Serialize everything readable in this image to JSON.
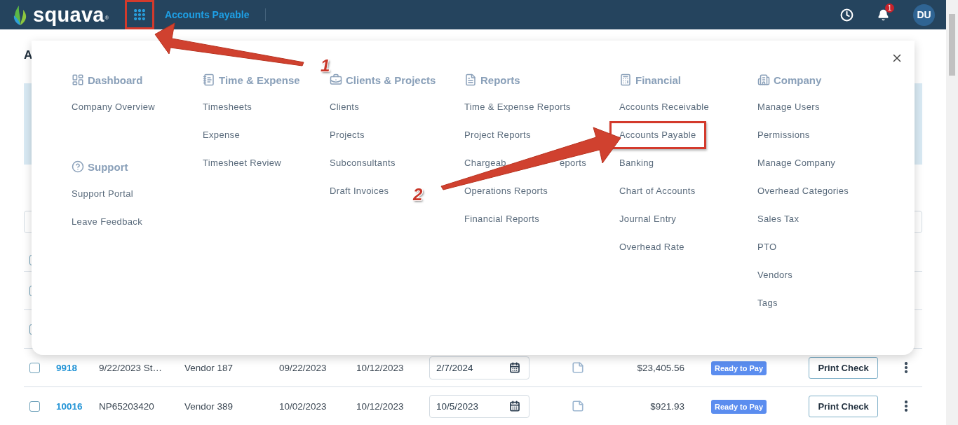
{
  "header": {
    "logo_text": "squava",
    "logo_mark": "®",
    "apps_button": {
      "highlighted": true
    },
    "page_link": "Accounts Payable",
    "notification_count": "1",
    "avatar": "DU"
  },
  "page": {
    "title_visible": "A"
  },
  "menu": {
    "columns": [
      {
        "groups": [
          {
            "title": "Dashboard",
            "items": [
              {
                "label": "Company Overview",
                "highlighted": false
              }
            ]
          },
          {
            "title": "Support",
            "items": [
              {
                "label": "Support Portal",
                "highlighted": false
              },
              {
                "label": "Leave Feedback",
                "highlighted": false
              }
            ]
          }
        ]
      },
      {
        "groups": [
          {
            "title": "Time & Expense",
            "items": [
              {
                "label": "Timesheets",
                "highlighted": false
              },
              {
                "label": "Expense",
                "highlighted": false
              },
              {
                "label": "Timesheet Review",
                "highlighted": false
              }
            ]
          }
        ]
      },
      {
        "groups": [
          {
            "title": "Clients & Projects",
            "items": [
              {
                "label": "Clients",
                "highlighted": false
              },
              {
                "label": "Projects",
                "highlighted": false
              },
              {
                "label": "Subconsultants",
                "highlighted": false
              },
              {
                "label": "Draft Invoices",
                "highlighted": false
              }
            ]
          }
        ]
      },
      {
        "groups": [
          {
            "title": "Reports",
            "items": [
              {
                "label": "Time & Expense Reports",
                "highlighted": false
              },
              {
                "label": "Project Reports",
                "highlighted": false
              },
              {
                "label": "Chargeab",
                "label_tail": "eports",
                "highlighted": false
              },
              {
                "label": "Operations Reports",
                "highlighted": false
              },
              {
                "label": "Financial Reports",
                "highlighted": false
              }
            ]
          }
        ]
      },
      {
        "groups": [
          {
            "title": "Financial",
            "items": [
              {
                "label": "Accounts Receivable",
                "highlighted": false
              },
              {
                "label": "Accounts Payable",
                "highlighted": true
              },
              {
                "label": "Banking",
                "highlighted": false
              },
              {
                "label": "Chart of Accounts",
                "highlighted": false
              },
              {
                "label": "Journal Entry",
                "highlighted": false
              },
              {
                "label": "Overhead Rate",
                "highlighted": false
              }
            ]
          }
        ]
      },
      {
        "groups": [
          {
            "title": "Company",
            "items": [
              {
                "label": "Manage Users",
                "highlighted": false
              },
              {
                "label": "Permissions",
                "highlighted": false
              },
              {
                "label": "Manage Company",
                "highlighted": false
              },
              {
                "label": "Overhead Categories",
                "highlighted": false
              },
              {
                "label": "Sales Tax",
                "highlighted": false
              },
              {
                "label": "PTO",
                "highlighted": false
              },
              {
                "label": "Vendors",
                "highlighted": false
              },
              {
                "label": "Tags",
                "highlighted": false
              }
            ]
          }
        ]
      }
    ]
  },
  "table": {
    "select_all": {
      "checked": false
    },
    "rows": [
      {
        "checked": false
      },
      {
        "checked": false
      },
      {
        "checked": false,
        "number": "9918",
        "reference": "9/22/2023 St…",
        "vendor": "Vendor 187",
        "date": "09/22/2023",
        "due_date": "10/12/2023",
        "pay_date": "2/7/2024",
        "amount": "$23,405.56",
        "status": "Ready to Pay",
        "action": "Print Check"
      },
      {
        "checked": false,
        "number": "10016",
        "reference": "NP65203420",
        "vendor": "Vendor 389",
        "date": "10/02/2023",
        "due_date": "10/12/2023",
        "pay_date": "10/5/2023",
        "amount": "$921.93",
        "status": "Ready to Pay",
        "action": "Print Check"
      }
    ]
  },
  "annotations": [
    {
      "number": "1"
    },
    {
      "number": "2"
    }
  ]
}
